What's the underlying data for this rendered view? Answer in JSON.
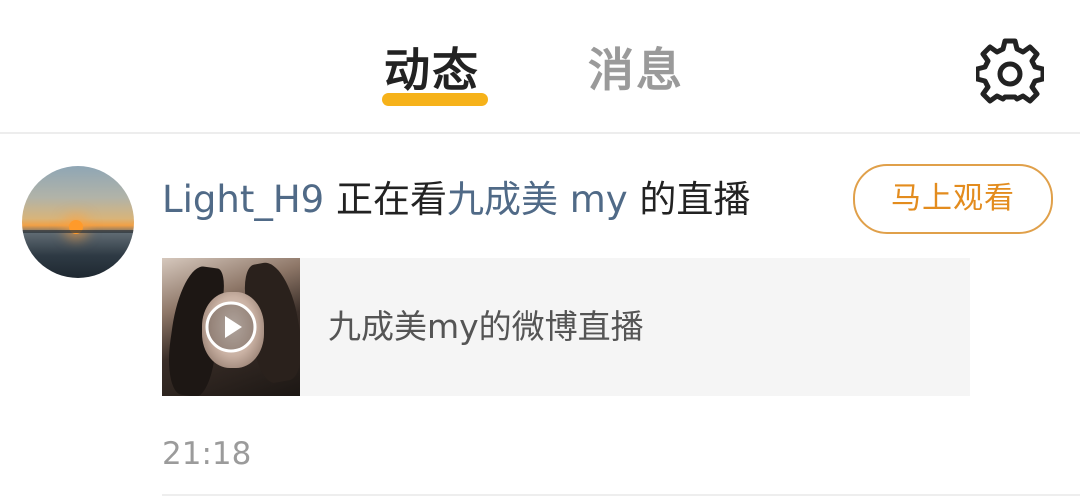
{
  "header": {
    "tabs": [
      {
        "label": "动态",
        "active": true
      },
      {
        "label": "消息",
        "active": false
      }
    ],
    "settings_icon": "gear-icon",
    "accent_color": "#f6b21a"
  },
  "feed_item": {
    "user": "Light_H9",
    "action_text": " 正在看",
    "target_user": "九成美 my",
    "action_suffix": " 的直播",
    "watch_button": "马上观看",
    "live_card": {
      "title": "九成美my的微博直播",
      "play_icon": "play-icon"
    },
    "timestamp": "21:18"
  }
}
